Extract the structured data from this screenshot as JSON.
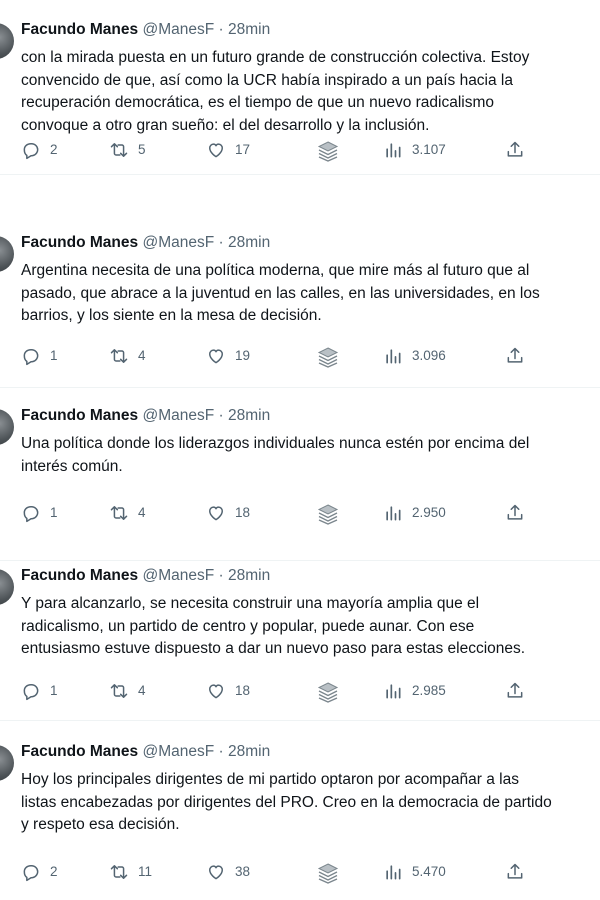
{
  "tweets": [
    {
      "author": "Facundo Manes",
      "handle": "@ManesF",
      "separator": "·",
      "time": "28min",
      "lines": [
        "con la mirada puesta en un futuro grande de construcción colectiva. Estoy",
        "convencido de que, así como la UCR había inspirado a un país hacia la",
        "recuperación democrática, es el tiempo de que un nuevo radicalismo",
        "convoque a otro gran sueño: el del desarrollo y la inclusión."
      ],
      "replies": "2",
      "retweets": "5",
      "likes": "17",
      "views": "3.107"
    },
    {
      "author": "Facundo Manes",
      "handle": "@ManesF",
      "separator": "·",
      "time": "28min",
      "lines": [
        "Argentina necesita de una política moderna, que mire más al futuro que al",
        "pasado, que abrace a la juventud en las calles, en las universidades, en los",
        "barrios, y los siente en la mesa de decisión."
      ],
      "replies": "1",
      "retweets": "4",
      "likes": "19",
      "views": "3.096"
    },
    {
      "author": "Facundo Manes",
      "handle": "@ManesF",
      "separator": "·",
      "time": "28min",
      "lines": [
        "Una política donde los liderazgos individuales nunca estén por encima del",
        "interés común."
      ],
      "replies": "1",
      "retweets": "4",
      "likes": "18",
      "views": "2.950"
    },
    {
      "author": "Facundo Manes",
      "handle": "@ManesF",
      "separator": "·",
      "time": "28min",
      "lines": [
        "Y para alcanzarlo, se necesita construir una mayoría amplia que el",
        "radicalismo, un partido de centro y popular, puede aunar. Con ese",
        "entusiasmo estuve dispuesto a dar un nuevo paso para estas elecciones."
      ],
      "replies": "1",
      "retweets": "4",
      "likes": "18",
      "views": "2.985"
    },
    {
      "author": "Facundo Manes",
      "handle": "@ManesF",
      "separator": "·",
      "time": "28min",
      "lines": [
        "Hoy los principales dirigentes de mi partido optaron por acompañar a las",
        "listas encabezadas por dirigentes del PRO. Creo en la democracia de partido",
        "y respeto esa decisión."
      ],
      "replies": "2",
      "retweets": "11",
      "likes": "38",
      "views": "5.470"
    }
  ],
  "icons": {
    "reply": "reply-icon",
    "retweet": "retweet-icon",
    "like": "heart-icon",
    "stack": "layers-icon",
    "views": "views-chart-icon",
    "share": "share-icon"
  },
  "colors": {
    "text": "#0f1419",
    "secondary": "#536471",
    "divider": "#eff3f4"
  }
}
